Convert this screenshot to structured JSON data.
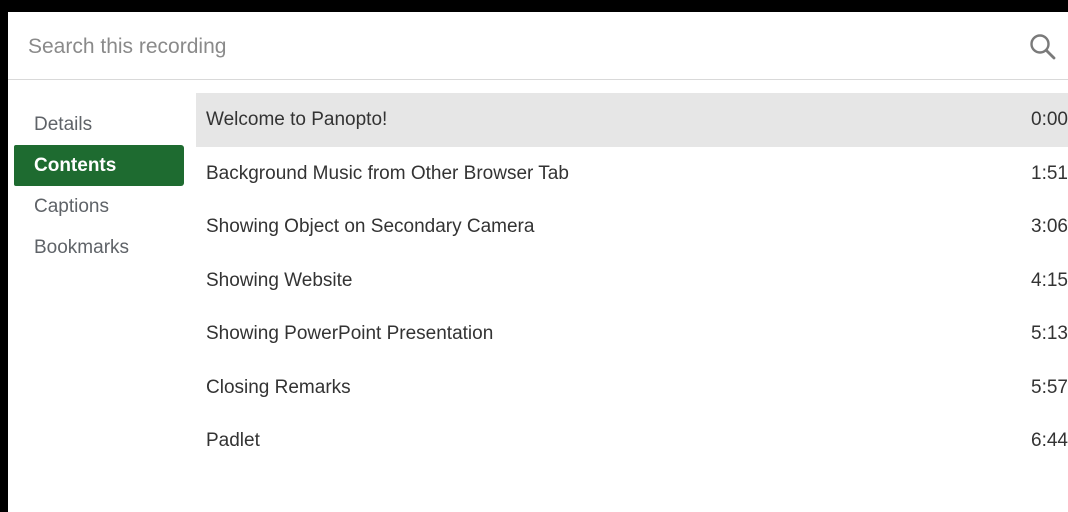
{
  "search": {
    "placeholder": "Search this recording",
    "value": ""
  },
  "sidebar": {
    "tabs": [
      {
        "label": "Details",
        "active": false
      },
      {
        "label": "Contents",
        "active": true
      },
      {
        "label": "Captions",
        "active": false
      },
      {
        "label": "Bookmarks",
        "active": false
      }
    ]
  },
  "contents": {
    "items": [
      {
        "title": "Welcome to Panopto!",
        "time": "0:00",
        "selected": true
      },
      {
        "title": "Background Music from Other Browser Tab",
        "time": "1:51",
        "selected": false
      },
      {
        "title": "Showing Object on Secondary Camera",
        "time": "3:06",
        "selected": false
      },
      {
        "title": "Showing Website",
        "time": "4:15",
        "selected": false
      },
      {
        "title": "Showing PowerPoint Presentation",
        "time": "5:13",
        "selected": false
      },
      {
        "title": "Closing Remarks",
        "time": "5:57",
        "selected": false
      },
      {
        "title": "Padlet",
        "time": "6:44",
        "selected": false
      }
    ]
  },
  "colors": {
    "active_tab_bg": "#1e6b30",
    "selected_row_bg": "#e6e6e6",
    "frame_border": "#000000"
  },
  "icons": {
    "search": "search-icon"
  }
}
